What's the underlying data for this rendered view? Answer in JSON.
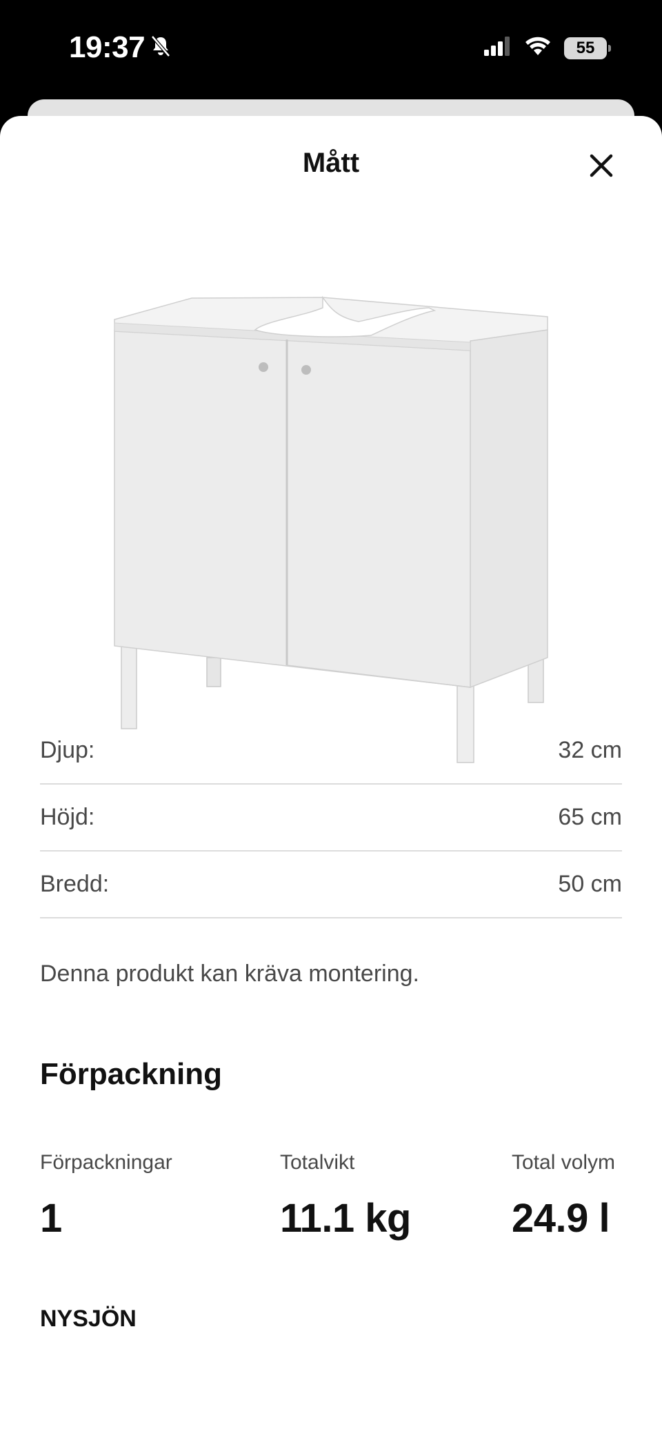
{
  "status_bar": {
    "time": "19:37",
    "battery": "55",
    "icons": [
      "bell-slash-icon",
      "signal-icon",
      "wifi-icon",
      "battery-icon"
    ]
  },
  "header": {
    "title": "Mått",
    "close_icon": "close-icon"
  },
  "product": {
    "image_description_icon": "cabinet-image"
  },
  "dimensions": [
    {
      "label": "Djup:",
      "value": "32 cm"
    },
    {
      "label": "Höjd:",
      "value": "65 cm"
    },
    {
      "label": "Bredd:",
      "value": "50 cm"
    }
  ],
  "assembly_note": "Denna produkt kan kräva montering.",
  "packaging": {
    "title": "Förpackning",
    "packages_label": "Förpackningar",
    "packages_value": "1",
    "weight_label": "Totalvikt",
    "weight_value": "11.1 kg",
    "volume_label": "Total volym",
    "volume_value": "24.9 l"
  },
  "next_section_title": "NYSJÖN"
}
